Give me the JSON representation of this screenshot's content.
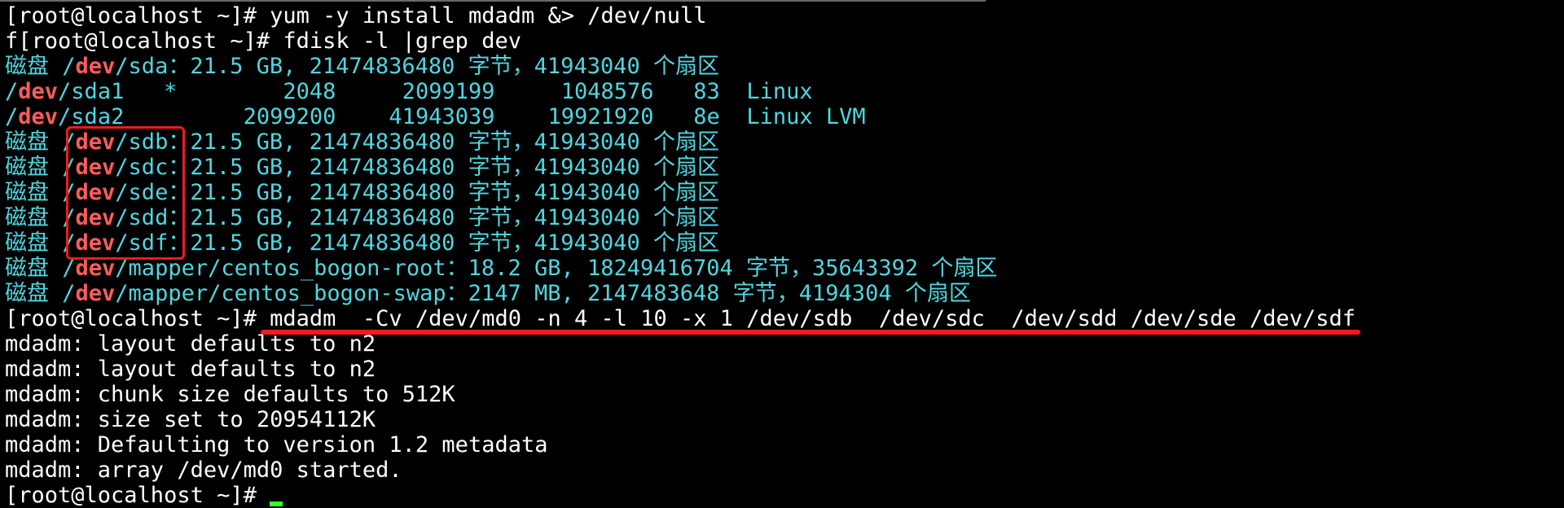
{
  "terminal": {
    "lines": [
      [
        {
          "t": "[root@localhost ~]# yum -y install mdadm &> /dev/null",
          "c": "w"
        }
      ],
      [
        {
          "t": "f[root@localhost ~]# fdisk -l |grep dev",
          "c": "w"
        }
      ],
      [
        {
          "t": "磁盘 /",
          "c": "c"
        },
        {
          "t": "dev",
          "c": "r"
        },
        {
          "t": "/sda：21.5 GB, 21474836480 字节，41943040 个扇区",
          "c": "c"
        }
      ],
      [
        {
          "t": "/",
          "c": "c"
        },
        {
          "t": "dev",
          "c": "r"
        },
        {
          "t": "/sda1   *        2048     2099199     1048576   83  Linux",
          "c": "c"
        }
      ],
      [
        {
          "t": "/",
          "c": "c"
        },
        {
          "t": "dev",
          "c": "r"
        },
        {
          "t": "/sda2         2099200    41943039    19921920   8e  Linux LVM",
          "c": "c"
        }
      ],
      [
        {
          "t": "磁盘 /",
          "c": "c"
        },
        {
          "t": "dev",
          "c": "r"
        },
        {
          "t": "/sdb：21.5 GB, 21474836480 字节，41943040 个扇区",
          "c": "c"
        }
      ],
      [
        {
          "t": "磁盘 /",
          "c": "c"
        },
        {
          "t": "dev",
          "c": "r"
        },
        {
          "t": "/sdc：21.5 GB, 21474836480 字节，41943040 个扇区",
          "c": "c"
        }
      ],
      [
        {
          "t": "磁盘 /",
          "c": "c"
        },
        {
          "t": "dev",
          "c": "r"
        },
        {
          "t": "/sde：21.5 GB, 21474836480 字节，41943040 个扇区",
          "c": "c"
        }
      ],
      [
        {
          "t": "磁盘 /",
          "c": "c"
        },
        {
          "t": "dev",
          "c": "r"
        },
        {
          "t": "/sdd：21.5 GB, 21474836480 字节，41943040 个扇区",
          "c": "c"
        }
      ],
      [
        {
          "t": "磁盘 /",
          "c": "c"
        },
        {
          "t": "dev",
          "c": "r"
        },
        {
          "t": "/sdf：21.5 GB, 21474836480 字节，41943040 个扇区",
          "c": "c"
        }
      ],
      [
        {
          "t": "磁盘 /",
          "c": "c"
        },
        {
          "t": "dev",
          "c": "r"
        },
        {
          "t": "/mapper/centos_bogon-root：18.2 GB, 18249416704 字节，35643392 个扇区",
          "c": "c"
        }
      ],
      [
        {
          "t": "磁盘 /",
          "c": "c"
        },
        {
          "t": "dev",
          "c": "r"
        },
        {
          "t": "/mapper/centos_bogon-swap：2147 MB, 2147483648 字节，4194304 个扇区",
          "c": "c"
        }
      ],
      [
        {
          "t": "[root@localhost ~]# mdadm  -Cv /dev/md0 -n 4 -l 10 -x 1 /dev/sdb  /dev/sdc  /dev/sdd /dev/sde /dev/sdf",
          "c": "w"
        }
      ],
      [
        {
          "t": "mdadm: layout defaults to n2",
          "c": "w"
        }
      ],
      [
        {
          "t": "mdadm: layout defaults to n2",
          "c": "w"
        }
      ],
      [
        {
          "t": "mdadm: chunk size defaults to 512K",
          "c": "w"
        }
      ],
      [
        {
          "t": "mdadm: size set to 20954112K",
          "c": "w"
        }
      ],
      [
        {
          "t": "mdadm: Defaulting to version 1.2 metadata",
          "c": "w"
        }
      ],
      [
        {
          "t": "mdadm: array /dev/md0 started.",
          "c": "w"
        }
      ],
      [
        {
          "t": "[root@localhost ~]# ",
          "c": "w"
        }
      ]
    ],
    "colors": {
      "background": "#000000",
      "default_text": "#ffffff",
      "cyan_text": "#4fd6e0",
      "dev_highlight": "#ff5c5c",
      "annotation_red": "#ee1c1c",
      "cursor": "#33ff33"
    }
  }
}
